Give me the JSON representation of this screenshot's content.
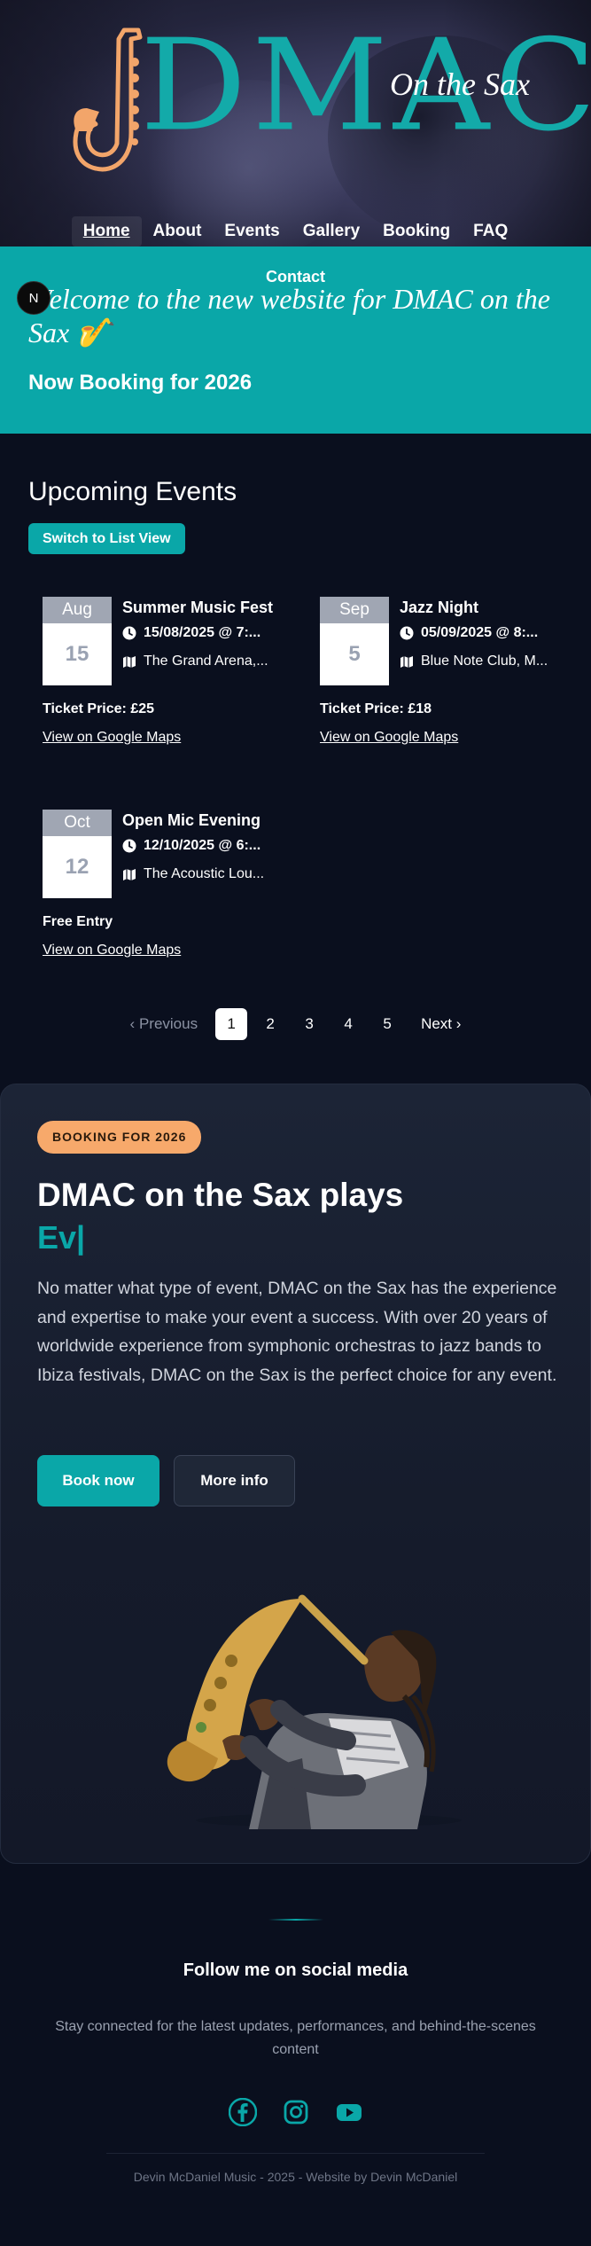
{
  "brand": {
    "logo_text": "DMAC",
    "logo_subtitle": "On the Sax",
    "accent": "#0aa7a8",
    "orange": "#f7a96b"
  },
  "nav": {
    "items": [
      "Home",
      "About",
      "Events",
      "Gallery",
      "Booking",
      "FAQ"
    ],
    "second_row": "Contact",
    "active": "Home"
  },
  "badge": {
    "letter": "N"
  },
  "banner": {
    "welcome": "Welcome to the new website for DMAC on the Sax 🎷",
    "booking": "Now Booking for 2026"
  },
  "events": {
    "title": "Upcoming Events",
    "switch_label": "Switch to List View",
    "items": [
      {
        "month": "Aug",
        "day": "15",
        "title": "Summer Music Fest",
        "datetime": "15/08/2025 @ 7:...",
        "venue": "The Grand Arena,...",
        "price": "Ticket Price: £25",
        "map_link": "View on Google Maps"
      },
      {
        "month": "Sep",
        "day": "5",
        "title": "Jazz Night",
        "datetime": "05/09/2025 @ 8:...",
        "venue": "Blue Note Club, M...",
        "price": "Ticket Price: £18",
        "map_link": "View on Google Maps"
      },
      {
        "month": "Oct",
        "day": "12",
        "title": "Open Mic Evening",
        "datetime": "12/10/2025 @ 6:...",
        "venue": "The Acoustic Lou...",
        "price": "Free Entry",
        "map_link": "View on Google Maps"
      }
    ],
    "pagination": {
      "previous": "Previous",
      "pages": [
        "1",
        "2",
        "3",
        "4",
        "5"
      ],
      "current": "1",
      "next": "Next"
    }
  },
  "promo": {
    "pill": "BOOKING FOR 2026",
    "heading": "DMAC on the Sax plays",
    "typed": "Ev|",
    "body": "No matter what type of event, DMAC on the Sax has the experience and expertise to make your event a success. With over 20 years of worldwide experience from symphonic orchestras to jazz bands to Ibiza festivals, DMAC on the Sax is the perfect choice for any event.",
    "book_now": "Book now",
    "more_info": "More info"
  },
  "footer": {
    "follow": "Follow me on social media",
    "stay": "Stay connected for the latest updates, performances, and behind-the-scenes content",
    "socials": [
      "facebook-icon",
      "instagram-icon",
      "youtube-icon"
    ],
    "copyright": "Devin McDaniel Music - 2025 - Website by Devin McDaniel"
  }
}
